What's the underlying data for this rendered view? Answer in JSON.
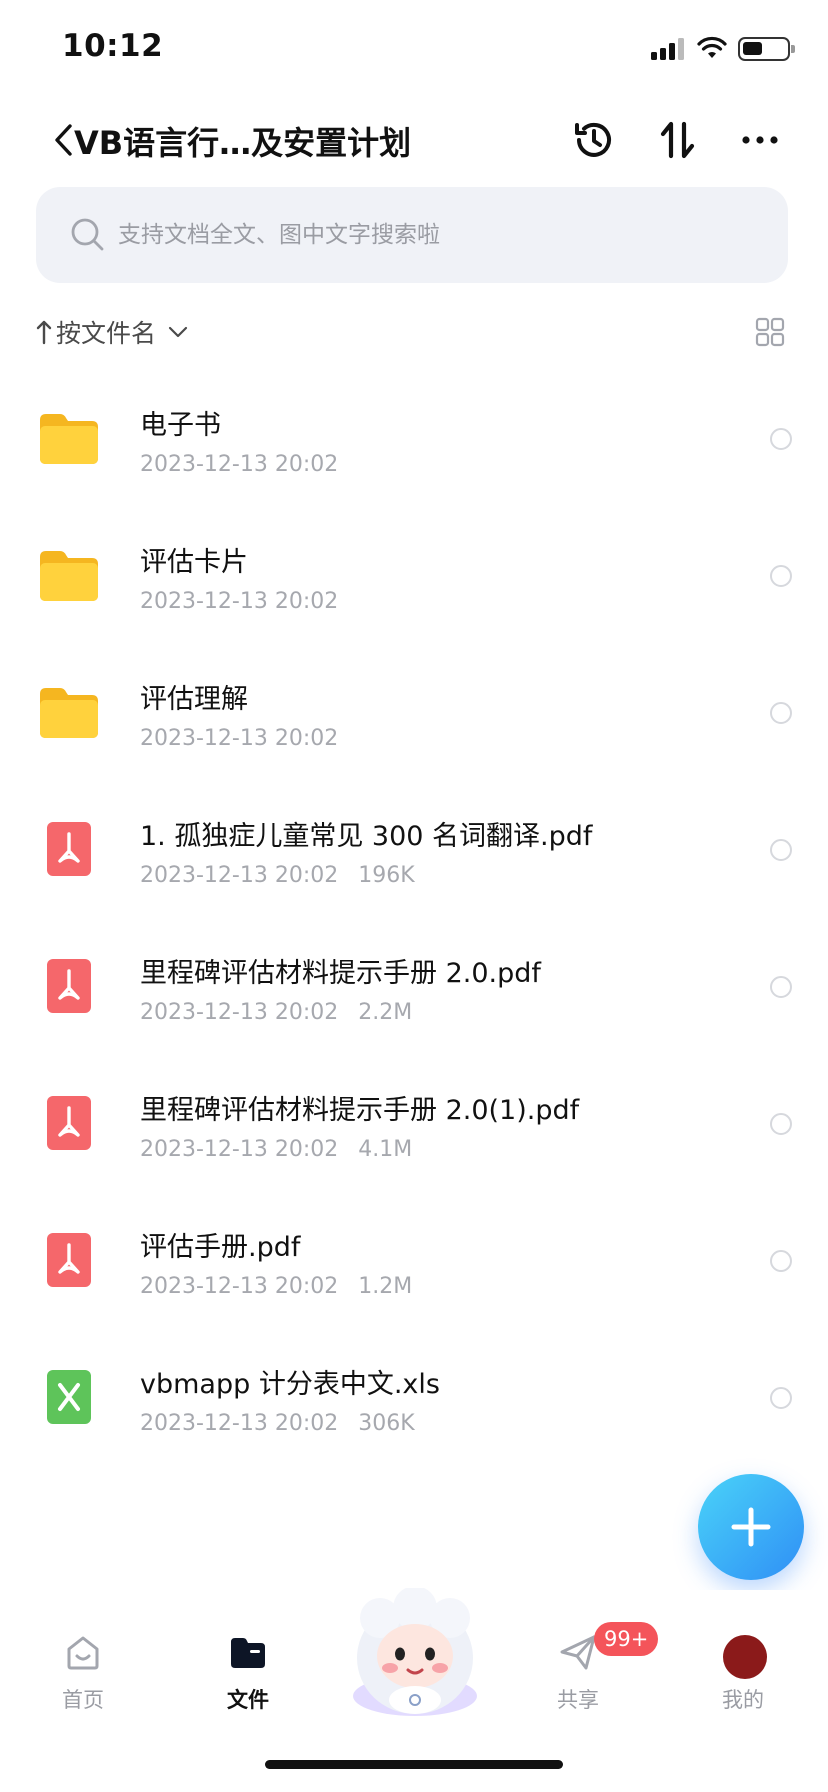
{
  "status_bar": {
    "time": "10:12"
  },
  "header": {
    "title": "VB语言行…及安置计划"
  },
  "search": {
    "placeholder": "支持文档全文、图中文字搜索啦"
  },
  "sort": {
    "label": "按文件名"
  },
  "files": [
    {
      "name": "电子书",
      "date": "2023-12-13 20:02",
      "size": "",
      "type": "folder"
    },
    {
      "name": "评估卡片",
      "date": "2023-12-13 20:02",
      "size": "",
      "type": "folder"
    },
    {
      "name": "评估理解",
      "date": "2023-12-13 20:02",
      "size": "",
      "type": "folder"
    },
    {
      "name": "1. 孤独症儿童常见 300 名词翻译.pdf",
      "date": "2023-12-13 20:02",
      "size": "196K",
      "type": "pdf"
    },
    {
      "name": "里程碑评估材料提示手册 2.0.pdf",
      "date": "2023-12-13 20:02",
      "size": "2.2M",
      "type": "pdf"
    },
    {
      "name": "里程碑评估材料提示手册 2.0(1).pdf",
      "date": "2023-12-13 20:02",
      "size": "4.1M",
      "type": "pdf"
    },
    {
      "name": "评估手册.pdf",
      "date": "2023-12-13 20:02",
      "size": "1.2M",
      "type": "pdf"
    },
    {
      "name": "vbmapp 计分表中文.xls",
      "date": "2023-12-13 20:02",
      "size": "306K",
      "type": "xls"
    }
  ],
  "tabbar": {
    "home": "首页",
    "files": "文件",
    "share": "共享",
    "mine": "我的",
    "share_badge": "99+"
  },
  "colors": {
    "folder": "#ffcc33",
    "pdf": "#f5676b",
    "xls": "#5ec45a",
    "fab": "#3aa9f7",
    "badge": "#f4545a"
  }
}
